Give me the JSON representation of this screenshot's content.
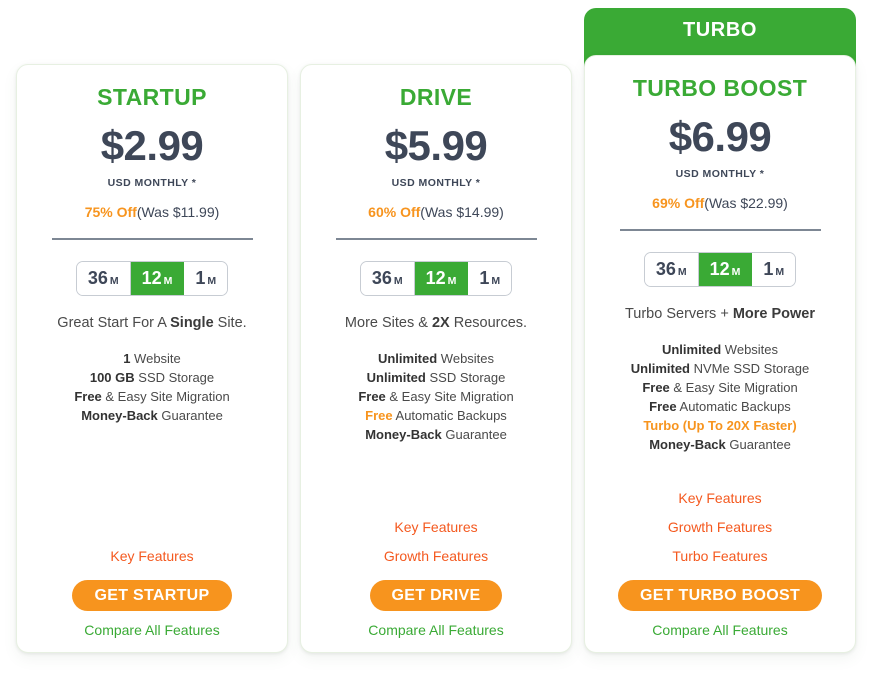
{
  "colors": {
    "brand_green": "#3aaa35",
    "accent_orange": "#f7941e",
    "link_orange": "#f4591f",
    "price_dark": "#3e4758",
    "card_border": "#e7f0e2"
  },
  "ribbon": {
    "label": "TURBO"
  },
  "plans": [
    {
      "id": "startup",
      "name": "STARTUP",
      "price": "$2.99",
      "price_unit": "USD MONTHLY *",
      "discount_pct": "75% Off",
      "discount_was": "(Was $11.99)",
      "terms": [
        {
          "value": "36",
          "suffix": "M",
          "active": false
        },
        {
          "value": "12",
          "suffix": "M",
          "active": true
        },
        {
          "value": "1",
          "suffix": "M",
          "active": false
        }
      ],
      "tagline_parts": [
        {
          "text": "Great Start For A ",
          "bold": false
        },
        {
          "text": "Single",
          "bold": true
        },
        {
          "text": " Site.",
          "bold": false
        }
      ],
      "features": [
        [
          {
            "text": "1",
            "style": "bold"
          },
          {
            "text": " Website",
            "style": "normal"
          }
        ],
        [
          {
            "text": "100 GB",
            "style": "bold"
          },
          {
            "text": " SSD Storage",
            "style": "normal"
          }
        ],
        [
          {
            "text": "Free",
            "style": "bold"
          },
          {
            "text": " & Easy Site Migration",
            "style": "normal"
          }
        ],
        [
          {
            "text": "Money-Back",
            "style": "bold"
          },
          {
            "text": " Guarantee",
            "style": "normal"
          }
        ]
      ],
      "feature_links": [
        "Key Features"
      ],
      "cta_label": "GET STARTUP",
      "compare_label": "Compare All Features"
    },
    {
      "id": "drive",
      "name": "DRIVE",
      "price": "$5.99",
      "price_unit": "USD MONTHLY *",
      "discount_pct": "60% Off",
      "discount_was": "(Was $14.99)",
      "terms": [
        {
          "value": "36",
          "suffix": "M",
          "active": false
        },
        {
          "value": "12",
          "suffix": "M",
          "active": true
        },
        {
          "value": "1",
          "suffix": "M",
          "active": false
        }
      ],
      "tagline_parts": [
        {
          "text": "More Sites & ",
          "bold": false
        },
        {
          "text": "2X",
          "bold": true
        },
        {
          "text": " Resources.",
          "bold": false
        }
      ],
      "features": [
        [
          {
            "text": "Unlimited",
            "style": "bold"
          },
          {
            "text": " Websites",
            "style": "normal"
          }
        ],
        [
          {
            "text": "Unlimited",
            "style": "bold"
          },
          {
            "text": " SSD Storage",
            "style": "normal"
          }
        ],
        [
          {
            "text": "Free",
            "style": "bold"
          },
          {
            "text": " & Easy Site Migration",
            "style": "normal"
          }
        ],
        [
          {
            "text": "Free",
            "style": "highlight"
          },
          {
            "text": " Automatic Backups",
            "style": "normal"
          }
        ],
        [
          {
            "text": "Money-Back",
            "style": "bold"
          },
          {
            "text": " Guarantee",
            "style": "normal"
          }
        ]
      ],
      "feature_links": [
        "Key Features",
        "Growth Features"
      ],
      "cta_label": "GET DRIVE",
      "compare_label": "Compare All Features"
    },
    {
      "id": "turbo-boost",
      "name": "TURBO BOOST",
      "price": "$6.99",
      "price_unit": "USD MONTHLY *",
      "discount_pct": "69% Off",
      "discount_was": "(Was $22.99)",
      "terms": [
        {
          "value": "36",
          "suffix": "M",
          "active": false
        },
        {
          "value": "12",
          "suffix": "M",
          "active": true
        },
        {
          "value": "1",
          "suffix": "M",
          "active": false
        }
      ],
      "tagline_parts": [
        {
          "text": "Turbo Servers + ",
          "bold": false
        },
        {
          "text": "More Power",
          "bold": true
        }
      ],
      "features": [
        [
          {
            "text": "Unlimited",
            "style": "bold"
          },
          {
            "text": " Websites",
            "style": "normal"
          }
        ],
        [
          {
            "text": "Unlimited",
            "style": "bold"
          },
          {
            "text": " NVMe SSD Storage",
            "style": "normal"
          }
        ],
        [
          {
            "text": "Free",
            "style": "bold"
          },
          {
            "text": " & Easy Site Migration",
            "style": "normal"
          }
        ],
        [
          {
            "text": "Free",
            "style": "bold"
          },
          {
            "text": " Automatic Backups",
            "style": "normal"
          }
        ],
        [
          {
            "text": "Turbo (Up To 20X Faster)",
            "style": "highlight"
          }
        ],
        [
          {
            "text": "Money-Back",
            "style": "bold"
          },
          {
            "text": " Guarantee",
            "style": "normal"
          }
        ]
      ],
      "feature_links": [
        "Key Features",
        "Growth Features",
        "Turbo Features"
      ],
      "cta_label": "GET TURBO BOOST",
      "compare_label": "Compare All Features"
    }
  ]
}
